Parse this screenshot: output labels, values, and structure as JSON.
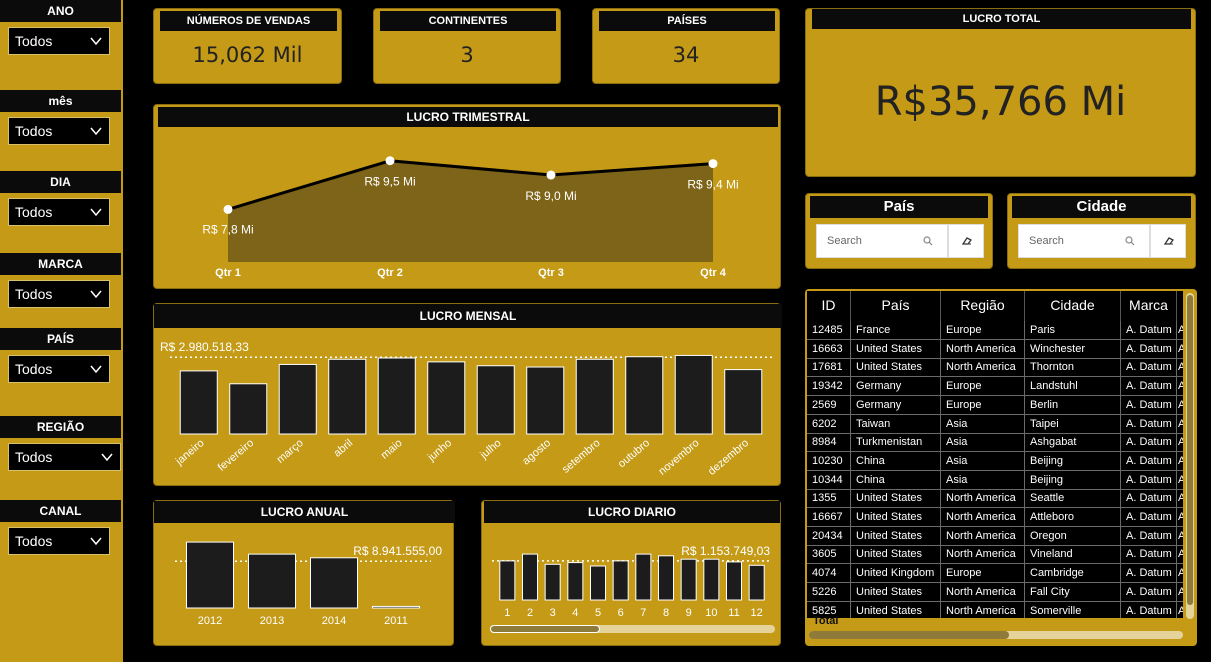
{
  "filters": [
    {
      "title": "ANO",
      "value": "Todos"
    },
    {
      "title": "mês",
      "value": "Todos"
    },
    {
      "title": "DIA",
      "value": "Todos"
    },
    {
      "title": "MARCA",
      "value": "Todos"
    },
    {
      "title": "PAÍS",
      "value": "Todos"
    },
    {
      "title": "REGIÃO",
      "value": "Todos"
    },
    {
      "title": "CANAL",
      "value": "Todos"
    }
  ],
  "kpis": {
    "vendas": {
      "title": "NÚMEROS DE VENDAS",
      "value": "15,062 Mil"
    },
    "continentes": {
      "title": "CONTINENTES",
      "value": "3"
    },
    "paises": {
      "title": "PAÍSES",
      "value": "34"
    },
    "lucro_total": {
      "title": "LUCRO TOTAL",
      "value": "R$35,766 Mi"
    }
  },
  "search": {
    "pais": {
      "title": "País",
      "placeholder": "Search"
    },
    "cidade": {
      "title": "Cidade",
      "placeholder": "Search"
    }
  },
  "colors": {
    "accent": "#c49a17",
    "dark": "#0b0b0b",
    "area": "#7d6419"
  },
  "chart_data": [
    {
      "id": "trimestral",
      "type": "area",
      "title": "LUCRO TRIMESTRAL",
      "categories": [
        "Qtr 1",
        "Qtr 2",
        "Qtr 3",
        "Qtr 4"
      ],
      "values": [
        7.8,
        9.5,
        9.0,
        9.4
      ],
      "labels": [
        "R$ 7,8 Mi",
        "R$ 9,5 Mi",
        "R$ 9,0 Mi",
        "R$ 9,4 Mi"
      ],
      "unit": "Mi"
    },
    {
      "id": "mensal",
      "type": "bar",
      "title": "LUCRO MENSAL",
      "categories": [
        "janeiro",
        "fevereiro",
        "março",
        "abril",
        "maio",
        "junho",
        "julho",
        "agosto",
        "setembro",
        "outubro",
        "novembro",
        "dezembro"
      ],
      "values": [
        2.45,
        1.95,
        2.7,
        2.9,
        2.95,
        2.8,
        2.65,
        2.6,
        2.9,
        3.0,
        3.05,
        2.5
      ],
      "reference_line": {
        "value": 2.98,
        "label": "R$ 2.980.518,33"
      }
    },
    {
      "id": "anual",
      "type": "bar",
      "title": "LUCRO ANUAL",
      "categories": [
        "2012",
        "2013",
        "2014",
        "2011"
      ],
      "values": [
        12.6,
        10.3,
        9.6,
        0.3
      ],
      "reference_line": {
        "value": 8.94,
        "label": "R$ 8.941.555,00"
      }
    },
    {
      "id": "diario",
      "type": "bar",
      "title": "LUCRO DIARIO",
      "categories": [
        "1",
        "2",
        "3",
        "4",
        "5",
        "6",
        "7",
        "8",
        "9",
        "10",
        "11",
        "12"
      ],
      "values": [
        1.15,
        1.35,
        1.05,
        1.1,
        1.0,
        1.15,
        1.35,
        1.3,
        1.2,
        1.2,
        1.12,
        1.02
      ],
      "reference_line": {
        "value": 1.15,
        "label": "R$ 1.153.749,03"
      }
    }
  ],
  "table": {
    "columns": [
      "ID",
      "País",
      "Região",
      "Cidade",
      "Marca",
      "A"
    ],
    "rows": [
      [
        "12485",
        "France",
        "Europe",
        "Paris",
        "A. Datum",
        "A"
      ],
      [
        "16663",
        "United States",
        "North America",
        "Winchester",
        "A. Datum",
        "A"
      ],
      [
        "17681",
        "United States",
        "North America",
        "Thornton",
        "A. Datum",
        "A"
      ],
      [
        "19342",
        "Germany",
        "Europe",
        "Landstuhl",
        "A. Datum",
        "A"
      ],
      [
        "2569",
        "Germany",
        "Europe",
        "Berlin",
        "A. Datum",
        "A"
      ],
      [
        "6202",
        "Taiwan",
        "Asia",
        "Taipei",
        "A. Datum",
        "A"
      ],
      [
        "8984",
        "Turkmenistan",
        "Asia",
        "Ashgabat",
        "A. Datum",
        "A"
      ],
      [
        "10230",
        "China",
        "Asia",
        "Beijing",
        "A. Datum",
        "A"
      ],
      [
        "10344",
        "China",
        "Asia",
        "Beijing",
        "A. Datum",
        "A"
      ],
      [
        "1355",
        "United States",
        "North America",
        "Seattle",
        "A. Datum",
        "A"
      ],
      [
        "16667",
        "United States",
        "North America",
        "Attleboro",
        "A. Datum",
        "A"
      ],
      [
        "20434",
        "United States",
        "North America",
        "Oregon",
        "A. Datum",
        "A"
      ],
      [
        "3605",
        "United States",
        "North America",
        "Vineland",
        "A. Datum",
        "A"
      ],
      [
        "4074",
        "United Kingdom",
        "Europe",
        "Cambridge",
        "A. Datum",
        "A"
      ],
      [
        "5226",
        "United States",
        "North America",
        "Fall City",
        "A. Datum",
        "A"
      ],
      [
        "5825",
        "United States",
        "North America",
        "Somerville",
        "A. Datum",
        "A"
      ]
    ],
    "total_label": "Total"
  }
}
